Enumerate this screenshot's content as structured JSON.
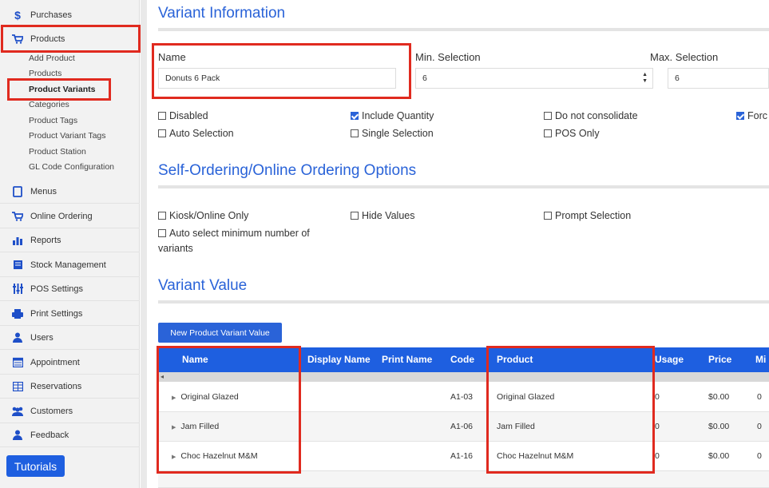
{
  "sidebar": {
    "items": [
      {
        "label": "Purchases",
        "icon": "dollar-icon"
      },
      {
        "label": "Products",
        "icon": "cart-icon"
      },
      {
        "label": "Menus",
        "icon": "tablet-icon"
      },
      {
        "label": "Online Ordering",
        "icon": "cart-icon"
      },
      {
        "label": "Reports",
        "icon": "bar-chart-icon"
      },
      {
        "label": "Stock Management",
        "icon": "book-icon"
      },
      {
        "label": "POS Settings",
        "icon": "sliders-icon"
      },
      {
        "label": "Print Settings",
        "icon": "printer-icon"
      },
      {
        "label": "Users",
        "icon": "user-icon"
      },
      {
        "label": "Appointment",
        "icon": "calendar-icon"
      },
      {
        "label": "Reservations",
        "icon": "table-icon"
      },
      {
        "label": "Customers",
        "icon": "group-icon"
      },
      {
        "label": "Feedback",
        "icon": "user-icon"
      }
    ],
    "sub_items": [
      "Add Product",
      "Products",
      "Product Variants",
      "Categories",
      "Product Tags",
      "Product Variant Tags",
      "Product Station",
      "GL Code Configuration"
    ],
    "tutorials_label": "Tutorials"
  },
  "variant_info": {
    "title": "Variant Information",
    "name_label": "Name",
    "name_value": "Donuts 6 Pack",
    "min_label": "Min. Selection",
    "min_value": "6",
    "max_label": "Max. Selection",
    "max_value": "6",
    "checkboxes": [
      {
        "label": "Disabled",
        "checked": false
      },
      {
        "label": "Include Quantity",
        "checked": true
      },
      {
        "label": "Do not consolidate",
        "checked": false
      },
      {
        "label": "Forc",
        "checked": true
      },
      {
        "label": "Auto Selection",
        "checked": false
      },
      {
        "label": "Single Selection",
        "checked": false
      },
      {
        "label": "POS Only",
        "checked": false
      }
    ]
  },
  "self_ordering": {
    "title": "Self-Ordering/Online Ordering Options",
    "checkboxes": [
      {
        "label": "Kiosk/Online Only",
        "checked": false
      },
      {
        "label": "Hide Values",
        "checked": false
      },
      {
        "label": "Prompt Selection",
        "checked": false
      },
      {
        "label": "Auto select minimum number of",
        "label2": "variants",
        "checked": false
      }
    ]
  },
  "variant_value": {
    "title": "Variant Value",
    "new_button": "New Product Variant Value",
    "columns": [
      "Name",
      "Display Name",
      "Print Name",
      "Code",
      "Product",
      "Usage",
      "Price",
      "Mi"
    ],
    "rows": [
      {
        "name": "Original Glazed",
        "code": "A1-03",
        "product": "Original Glazed",
        "usage": "0",
        "price": "$0.00",
        "min": "0"
      },
      {
        "name": "Jam Filled",
        "code": "A1-06",
        "product": "Jam Filled",
        "usage": "0",
        "price": "$0.00",
        "min": "0"
      },
      {
        "name": "Choc Hazelnut M&M",
        "code": "A1-16",
        "product": "Choc Hazelnut M&M",
        "usage": "0",
        "price": "$0.00",
        "min": "0"
      }
    ]
  },
  "colors": {
    "accent": "#1e5fe0",
    "highlight": "#e02a1f",
    "title": "#2a63d8"
  }
}
